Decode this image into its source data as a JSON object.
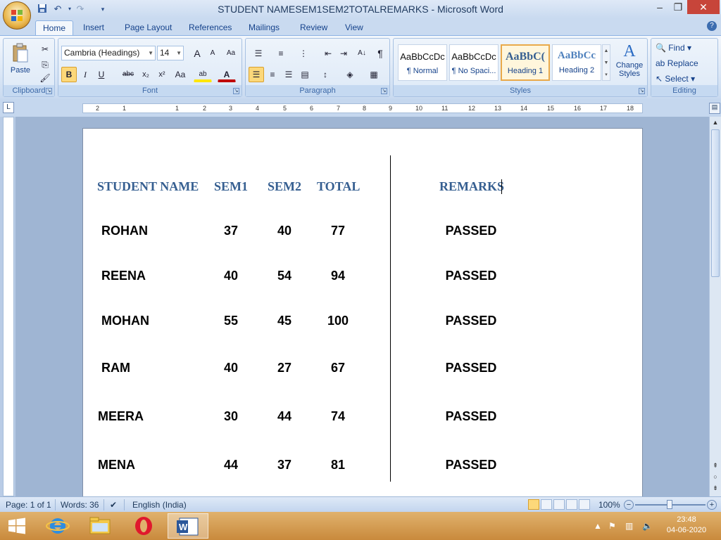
{
  "window": {
    "title": "STUDENT NAMESEM1SEM2TOTALREMARKS - Microsoft Word",
    "minimize": "–",
    "restore": "❐",
    "close": "✕"
  },
  "quick_access": {
    "save": "💾",
    "undo": "↶",
    "redo": "↷",
    "customize": "▾"
  },
  "tabs": [
    "Home",
    "Insert",
    "Page Layout",
    "References",
    "Mailings",
    "Review",
    "View"
  ],
  "ribbon": {
    "clipboard": {
      "label": "Clipboard",
      "paste": "Paste"
    },
    "font": {
      "label": "Font",
      "family": "Cambria (Headings)",
      "size": "14",
      "grow": "A",
      "shrink": "A",
      "clear": "Aa",
      "bold": "B",
      "italic": "I",
      "underline": "U",
      "strike": "abc",
      "subscript": "x₂",
      "superscript": "x²",
      "case": "Aa",
      "highlight": "ab",
      "color": "A"
    },
    "paragraph": {
      "label": "Paragraph",
      "pilcrow": "¶",
      "sort": "A↓"
    },
    "styles": {
      "label": "Styles",
      "items": [
        {
          "sample": "AaBbCcDc",
          "name": "¶ Normal"
        },
        {
          "sample": "AaBbCcDc",
          "name": "¶ No Spaci..."
        },
        {
          "sample": "AaBbC(",
          "name": "Heading 1"
        },
        {
          "sample": "AaBbCc",
          "name": "Heading 2"
        }
      ],
      "change_styles": "Change Styles"
    },
    "editing": {
      "label": "Editing",
      "find": "Find",
      "replace": "Replace",
      "select": "Select"
    }
  },
  "ruler": {
    "marks": [
      "2",
      "1",
      "1",
      "2",
      "3",
      "4",
      "5",
      "6",
      "7",
      "8",
      "9",
      "10",
      "11",
      "12",
      "13",
      "14",
      "15",
      "16",
      "17",
      "18"
    ],
    "tab_selector": "L"
  },
  "document": {
    "headers": {
      "name": "STUDENT NAME",
      "sem1": "SEM1",
      "sem2": "SEM2",
      "total": "TOTAL",
      "remarks": "REMARKS"
    },
    "rows": [
      {
        "name": "ROHAN",
        "sem1": "37",
        "sem2": "40",
        "total": "77",
        "remarks": "PASSED"
      },
      {
        "name": "REENA",
        "sem1": "40",
        "sem2": "54",
        "total": "94",
        "remarks": "PASSED"
      },
      {
        "name": "MOHAN",
        "sem1": "55",
        "sem2": "45",
        "total": "100",
        "remarks": "PASSED"
      },
      {
        "name": "RAM",
        "sem1": "40",
        "sem2": "27",
        "total": "67",
        "remarks": "PASSED"
      },
      {
        "name": "MEERA",
        "sem1": "30",
        "sem2": "44",
        "total": "74",
        "remarks": "PASSED"
      },
      {
        "name": "MENA",
        "sem1": "44",
        "sem2": "37",
        "total": "81",
        "remarks": "PASSED"
      }
    ]
  },
  "statusbar": {
    "page": "Page: 1 of 1",
    "words": "Words: 36",
    "language": "English (India)",
    "zoom": "100%",
    "zoom_out": "−",
    "zoom_in": "+"
  },
  "taskbar": {
    "time": "23:48",
    "date": "04-06-2020"
  },
  "colors": {
    "heading": "#365f91",
    "ribbon": "#dbe7f6",
    "taskbar": "#c98a3c"
  }
}
